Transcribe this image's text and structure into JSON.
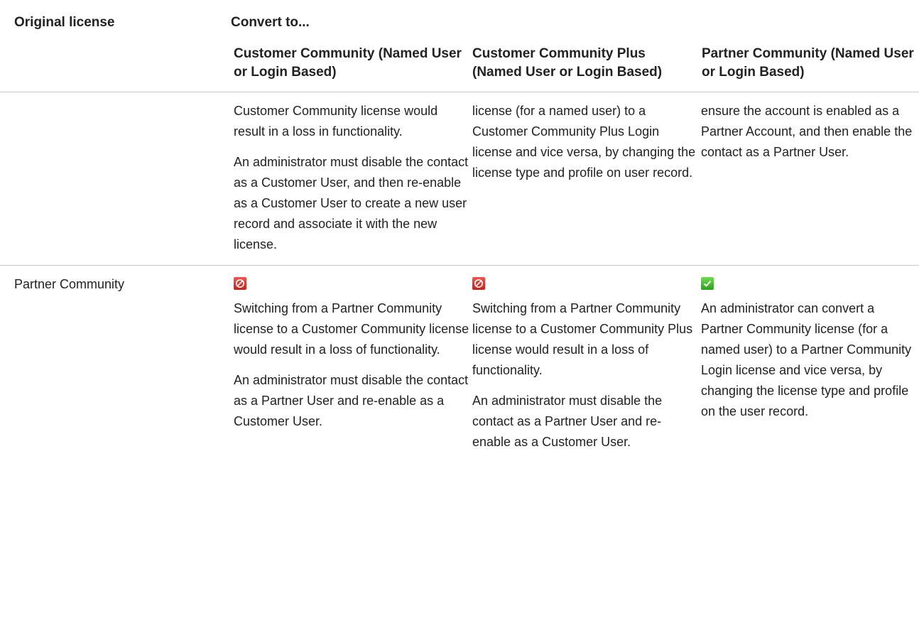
{
  "header": {
    "original_license": "Original license",
    "convert_to": "Convert to...",
    "columns": [
      "Customer Community (Named User or Login Based)",
      "Customer Community Plus (Named User or Login Based)",
      "Partner Community (Named User or Login Based)"
    ]
  },
  "rows": [
    {
      "original": "",
      "cells": [
        {
          "status": "",
          "paragraphs": [
            "Customer Community license would result in a loss in functionality.",
            "An administrator must disable the contact as a Customer User, and then re-enable as a Customer User to create a new user record and associate it with the new license."
          ]
        },
        {
          "status": "",
          "paragraphs": [
            "license (for a named user) to a Customer Community Plus Login license and vice versa, by changing the license type and profile on user record."
          ]
        },
        {
          "status": "",
          "paragraphs": [
            "ensure the account is enabled as a Partner Account, and then enable the contact as a Partner User."
          ]
        }
      ]
    },
    {
      "original": "Partner Community",
      "cells": [
        {
          "status": "not-allowed-icon",
          "paragraphs": [
            "Switching from a Partner Community license to a Customer Community license would result in a loss of functionality.",
            "An administrator must disable the contact as a Partner User and re-enable as a Customer User."
          ]
        },
        {
          "status": "not-allowed-icon",
          "paragraphs": [
            "Switching from a Partner Community license to a Customer Community Plus license would result in a loss of functionality.",
            "An administrator must disable the contact as a Partner User and re-enable as a Customer User."
          ]
        },
        {
          "status": "checkmark-icon",
          "paragraphs": [
            "An administrator can convert a Partner Community license (for a named user) to a Partner Community Login license and vice versa, by changing the license type and profile on the user record."
          ]
        }
      ]
    }
  ],
  "colors": {
    "not_allowed": "#d9302a",
    "allowed": "#45b82f",
    "rule": "#c9c9c9"
  }
}
